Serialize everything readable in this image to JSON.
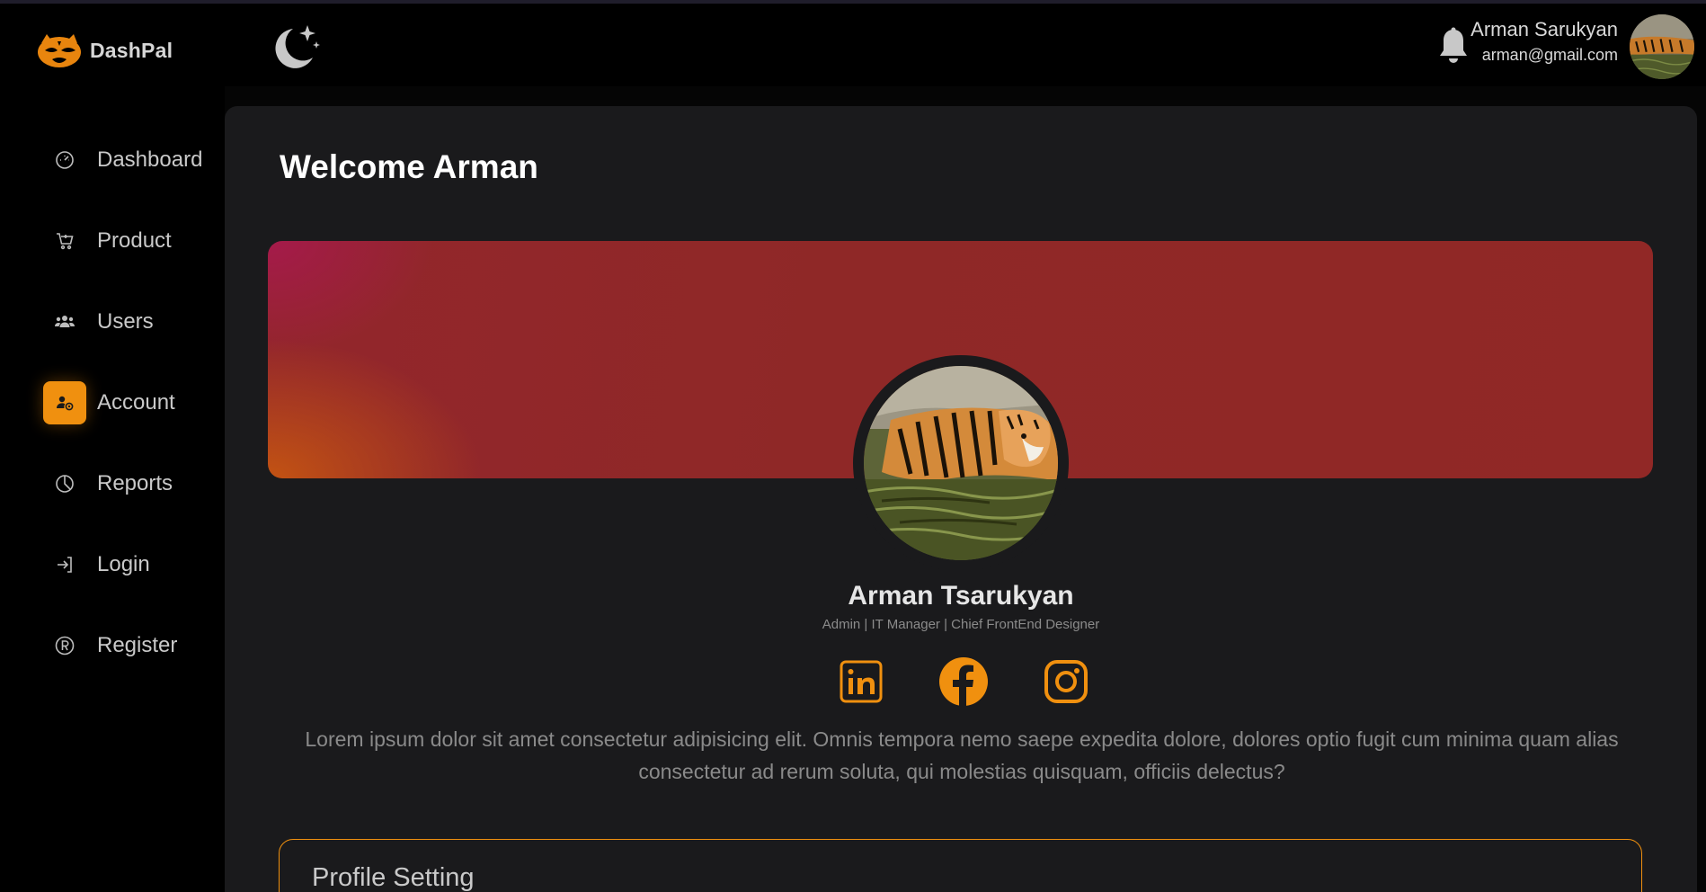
{
  "brand": {
    "name": "DashPal"
  },
  "sidebar": {
    "items": [
      {
        "label": "Dashboard",
        "icon": "dashboard-gauge-icon",
        "active": false
      },
      {
        "label": "Product",
        "icon": "cart-icon",
        "active": false
      },
      {
        "label": "Users",
        "icon": "users-icon",
        "active": false
      },
      {
        "label": "Account",
        "icon": "account-settings-icon",
        "active": true
      },
      {
        "label": "Reports",
        "icon": "pie-chart-icon",
        "active": false
      },
      {
        "label": "Login",
        "icon": "login-icon",
        "active": false
      },
      {
        "label": "Register",
        "icon": "registered-icon",
        "active": false
      }
    ]
  },
  "topbar": {
    "theme_icon": "moon-stars-icon",
    "notification_icon": "bell-icon",
    "user_name": "Arman Sarukyan",
    "user_email": "arman@gmail.com"
  },
  "main": {
    "welcome": "Welcome Arman",
    "profile": {
      "name": "Arman Tsarukyan",
      "role": "Admin | IT Manager | Chief FrontEnd Designer",
      "socials": [
        "linkedin-icon",
        "facebook-icon",
        "instagram-icon"
      ],
      "bio": "Lorem ipsum dolor sit amet consectetur adipisicing elit. Omnis tempora nemo saepe expedita dolore, dolores optio fugit cum minima quam alias consectetur ad rerum soluta, qui molestias quisquam, officiis delectus?"
    },
    "settings_title": "Profile Setting"
  },
  "colors": {
    "accent": "#f0900f",
    "background": "#000000",
    "panel": "#1a1a1c",
    "banner": "#912826"
  }
}
